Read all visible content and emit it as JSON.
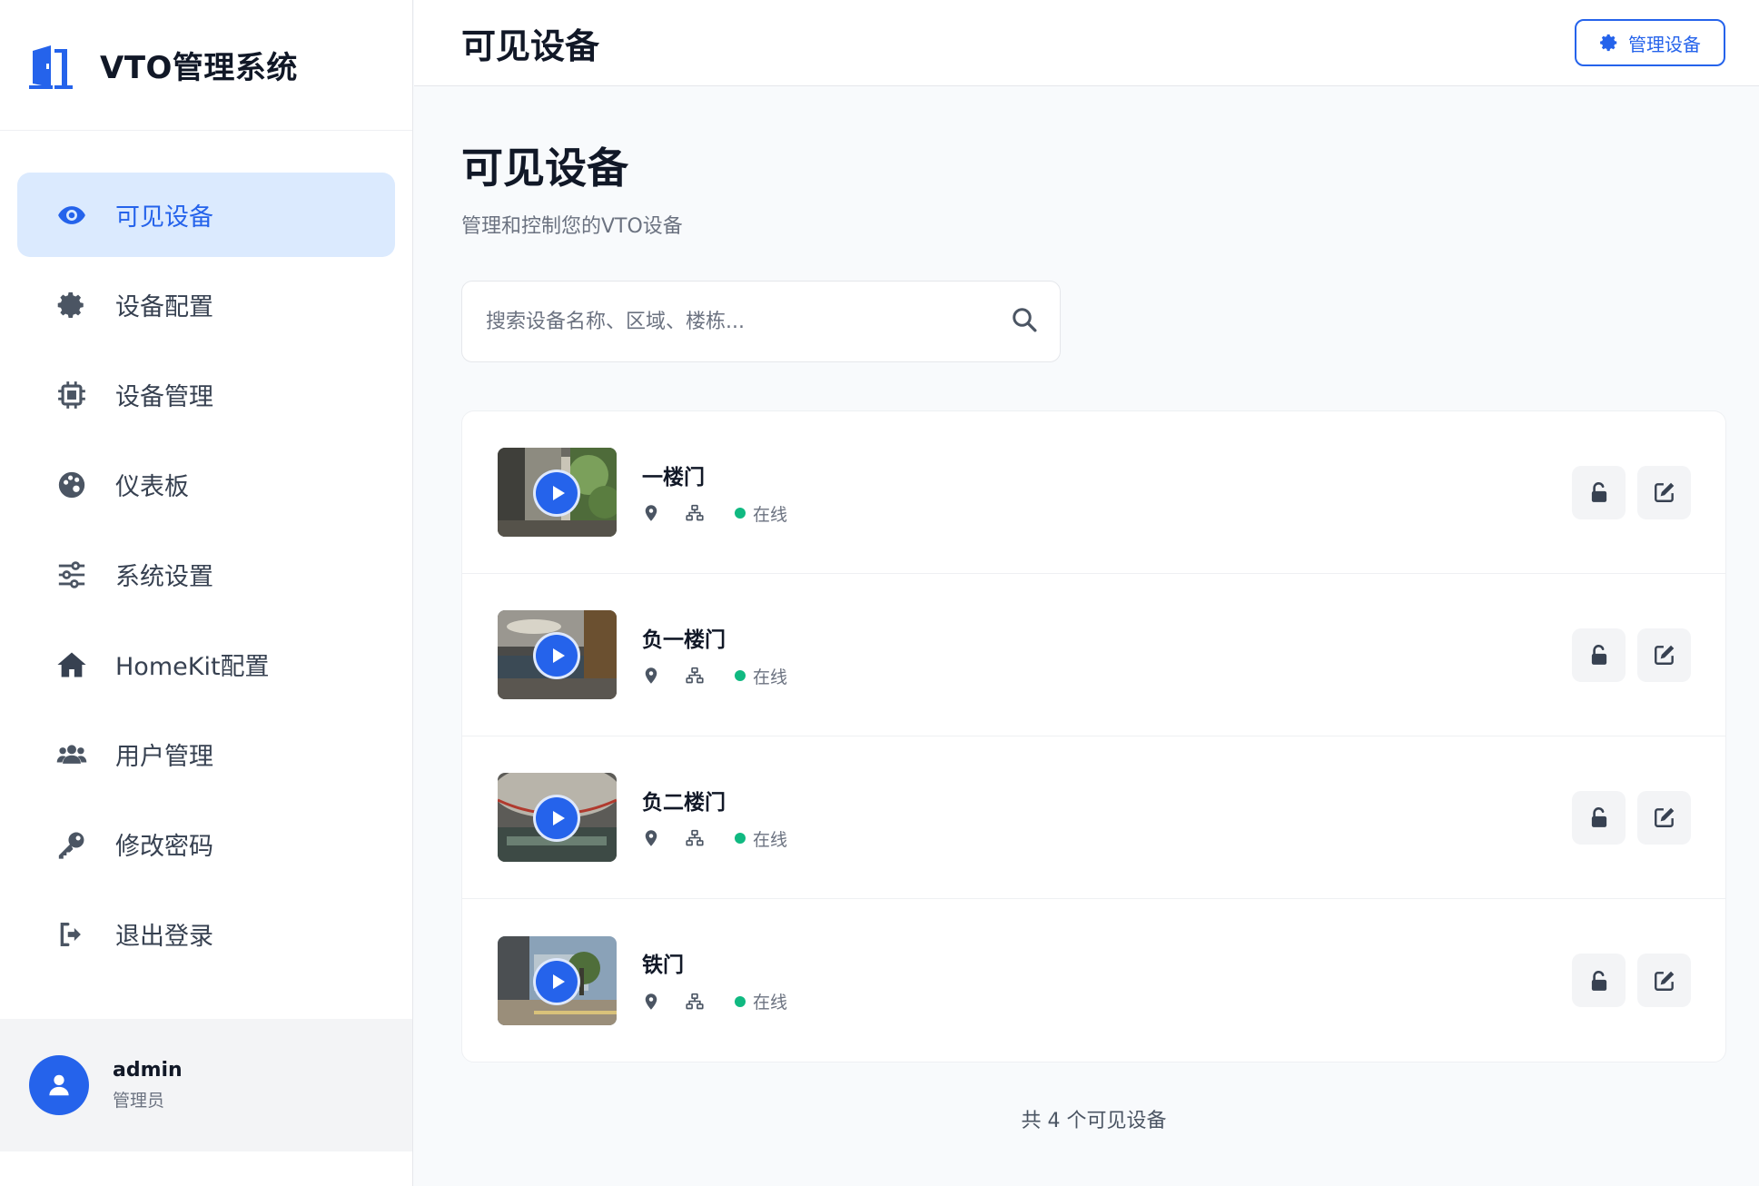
{
  "app": {
    "title": "VTO管理系统"
  },
  "sidebar": {
    "items": [
      {
        "label": "可见设备",
        "icon": "eye-icon",
        "active": true
      },
      {
        "label": "设备配置",
        "icon": "gear-icon",
        "active": false
      },
      {
        "label": "设备管理",
        "icon": "chip-icon",
        "active": false
      },
      {
        "label": "仪表板",
        "icon": "palette-icon",
        "active": false
      },
      {
        "label": "系统设置",
        "icon": "sliders-icon",
        "active": false
      },
      {
        "label": "HomeKit配置",
        "icon": "home-icon",
        "active": false
      },
      {
        "label": "用户管理",
        "icon": "users-icon",
        "active": false
      },
      {
        "label": "修改密码",
        "icon": "key-icon",
        "active": false
      },
      {
        "label": "退出登录",
        "icon": "logout-icon",
        "active": false
      }
    ],
    "user": {
      "name": "admin",
      "role": "管理员"
    }
  },
  "header": {
    "title": "可见设备",
    "manage_button": "管理设备"
  },
  "main": {
    "title": "可见设备",
    "subtitle": "管理和控制您的VTO设备",
    "search": {
      "placeholder": "搜索设备名称、区域、楼栋...",
      "value": ""
    },
    "devices": [
      {
        "name": "一楼门",
        "status": "在线"
      },
      {
        "name": "负一楼门",
        "status": "在线"
      },
      {
        "name": "负二楼门",
        "status": "在线"
      },
      {
        "name": "铁门",
        "status": "在线"
      }
    ],
    "count_text": "共 4 个可见设备"
  },
  "colors": {
    "accent": "#2563eb",
    "active_bg": "#dbeafe",
    "online": "#10b981"
  }
}
